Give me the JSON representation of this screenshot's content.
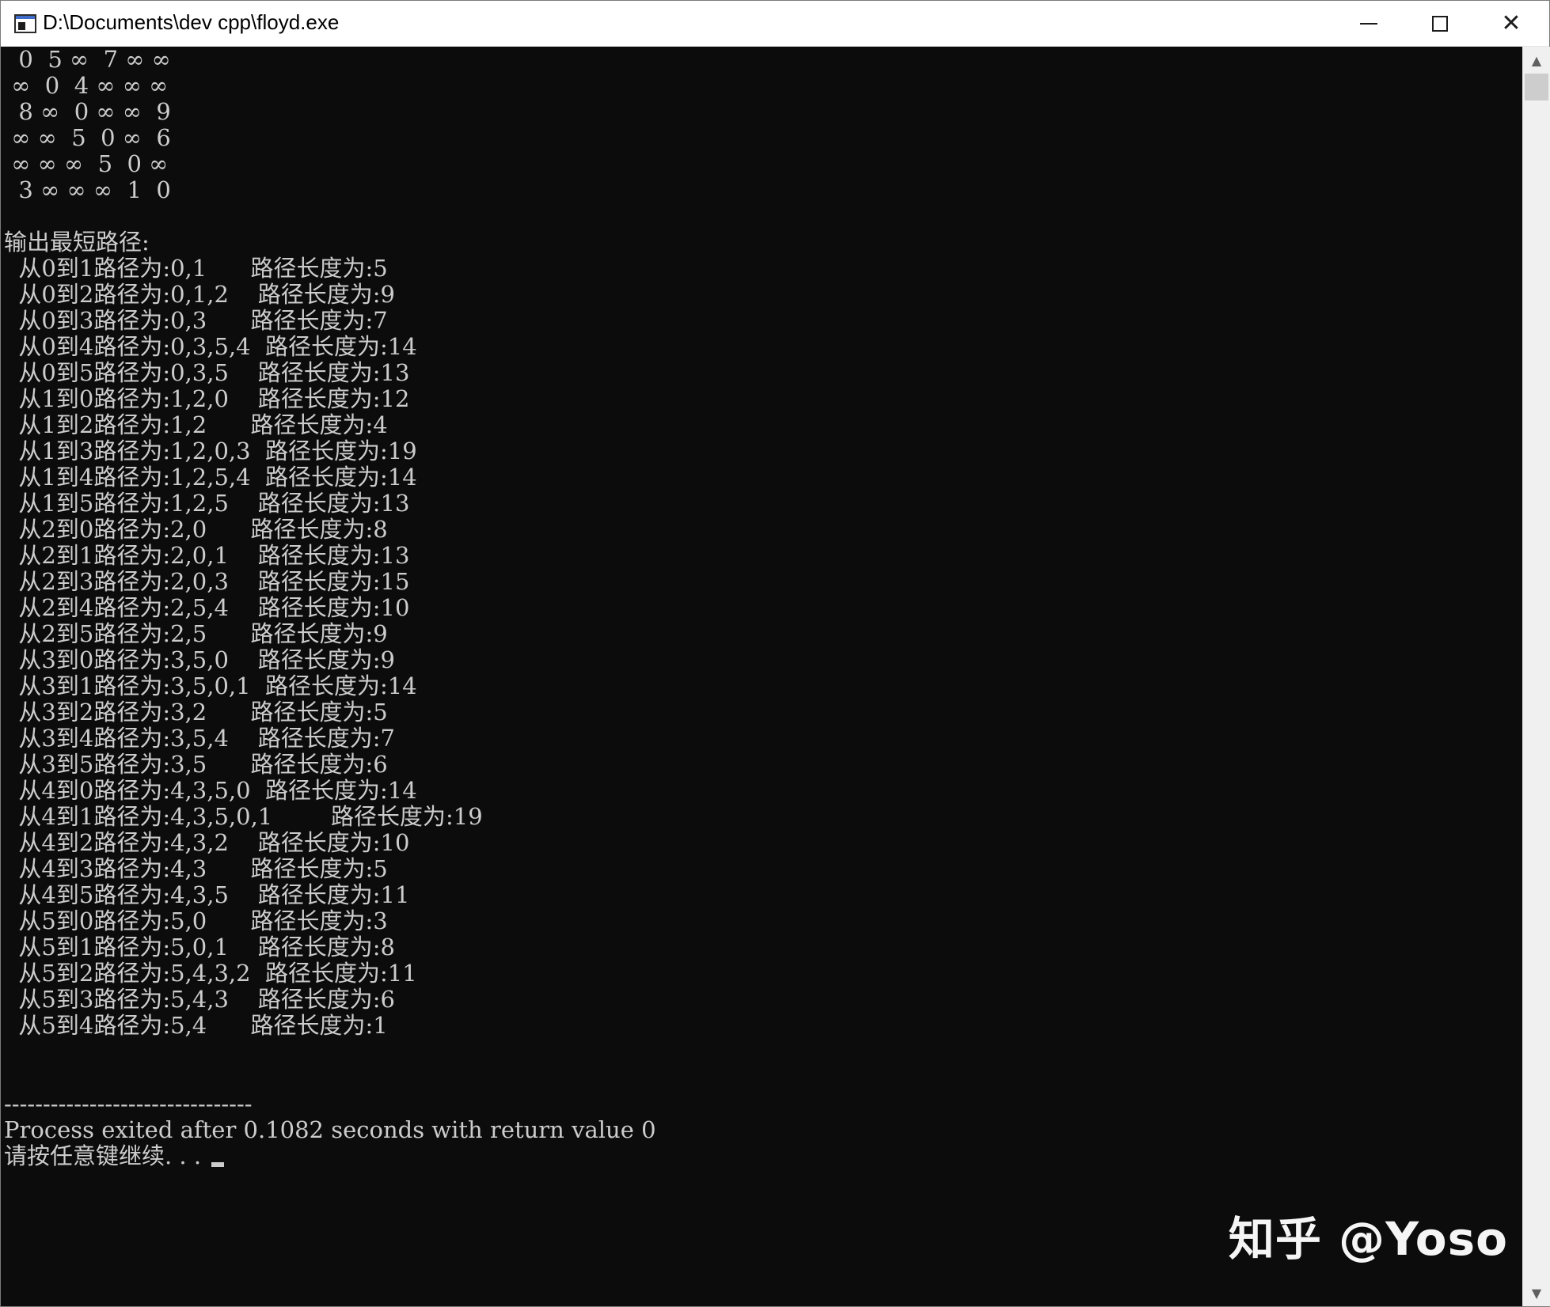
{
  "window": {
    "title": "D:\\Documents\\dev cpp\\floyd.exe",
    "buttons": {
      "minimize": "minimize-icon",
      "maximize": "maximize-icon",
      "close": "close-icon"
    }
  },
  "console": {
    "lines": [
      "  0  5 ∞  7 ∞ ∞",
      " ∞  0  4 ∞ ∞ ∞",
      "  8 ∞  0 ∞ ∞  9",
      " ∞ ∞  5  0 ∞  6",
      " ∞ ∞ ∞  5  0 ∞",
      "  3 ∞ ∞ ∞  1  0",
      "",
      "输出最短路径:",
      "  从0到1路径为:0,1      路径长度为:5",
      "  从0到2路径为:0,1,2    路径长度为:9",
      "  从0到3路径为:0,3      路径长度为:7",
      "  从0到4路径为:0,3,5,4  路径长度为:14",
      "  从0到5路径为:0,3,5    路径长度为:13",
      "  从1到0路径为:1,2,0    路径长度为:12",
      "  从1到2路径为:1,2      路径长度为:4",
      "  从1到3路径为:1,2,0,3  路径长度为:19",
      "  从1到4路径为:1,2,5,4  路径长度为:14",
      "  从1到5路径为:1,2,5    路径长度为:13",
      "  从2到0路径为:2,0      路径长度为:8",
      "  从2到1路径为:2,0,1    路径长度为:13",
      "  从2到3路径为:2,0,3    路径长度为:15",
      "  从2到4路径为:2,5,4    路径长度为:10",
      "  从2到5路径为:2,5      路径长度为:9",
      "  从3到0路径为:3,5,0    路径长度为:9",
      "  从3到1路径为:3,5,0,1  路径长度为:14",
      "  从3到2路径为:3,2      路径长度为:5",
      "  从3到4路径为:3,5,4    路径长度为:7",
      "  从3到5路径为:3,5      路径长度为:6",
      "  从4到0路径为:4,3,5,0  路径长度为:14",
      "  从4到1路径为:4,3,5,0,1        路径长度为:19",
      "  从4到2路径为:4,3,2    路径长度为:10",
      "  从4到3路径为:4,3      路径长度为:5",
      "  从4到5路径为:4,3,5    路径长度为:11",
      "  从5到0路径为:5,0      路径长度为:3",
      "  从5到1路径为:5,0,1    路径长度为:8",
      "  从5到2路径为:5,4,3,2  路径长度为:11",
      "  从5到3路径为:5,4,3    路径长度为:6",
      "  从5到4路径为:5,4      路径长度为:1",
      "",
      "",
      "--------------------------------",
      "Process exited after 0.1082 seconds with return value 0"
    ],
    "prompt": "请按任意键继续. . . "
  },
  "scrollbar": {
    "up_icon": "▲",
    "down_icon": "▼"
  },
  "watermark": "知乎 @Yoso"
}
